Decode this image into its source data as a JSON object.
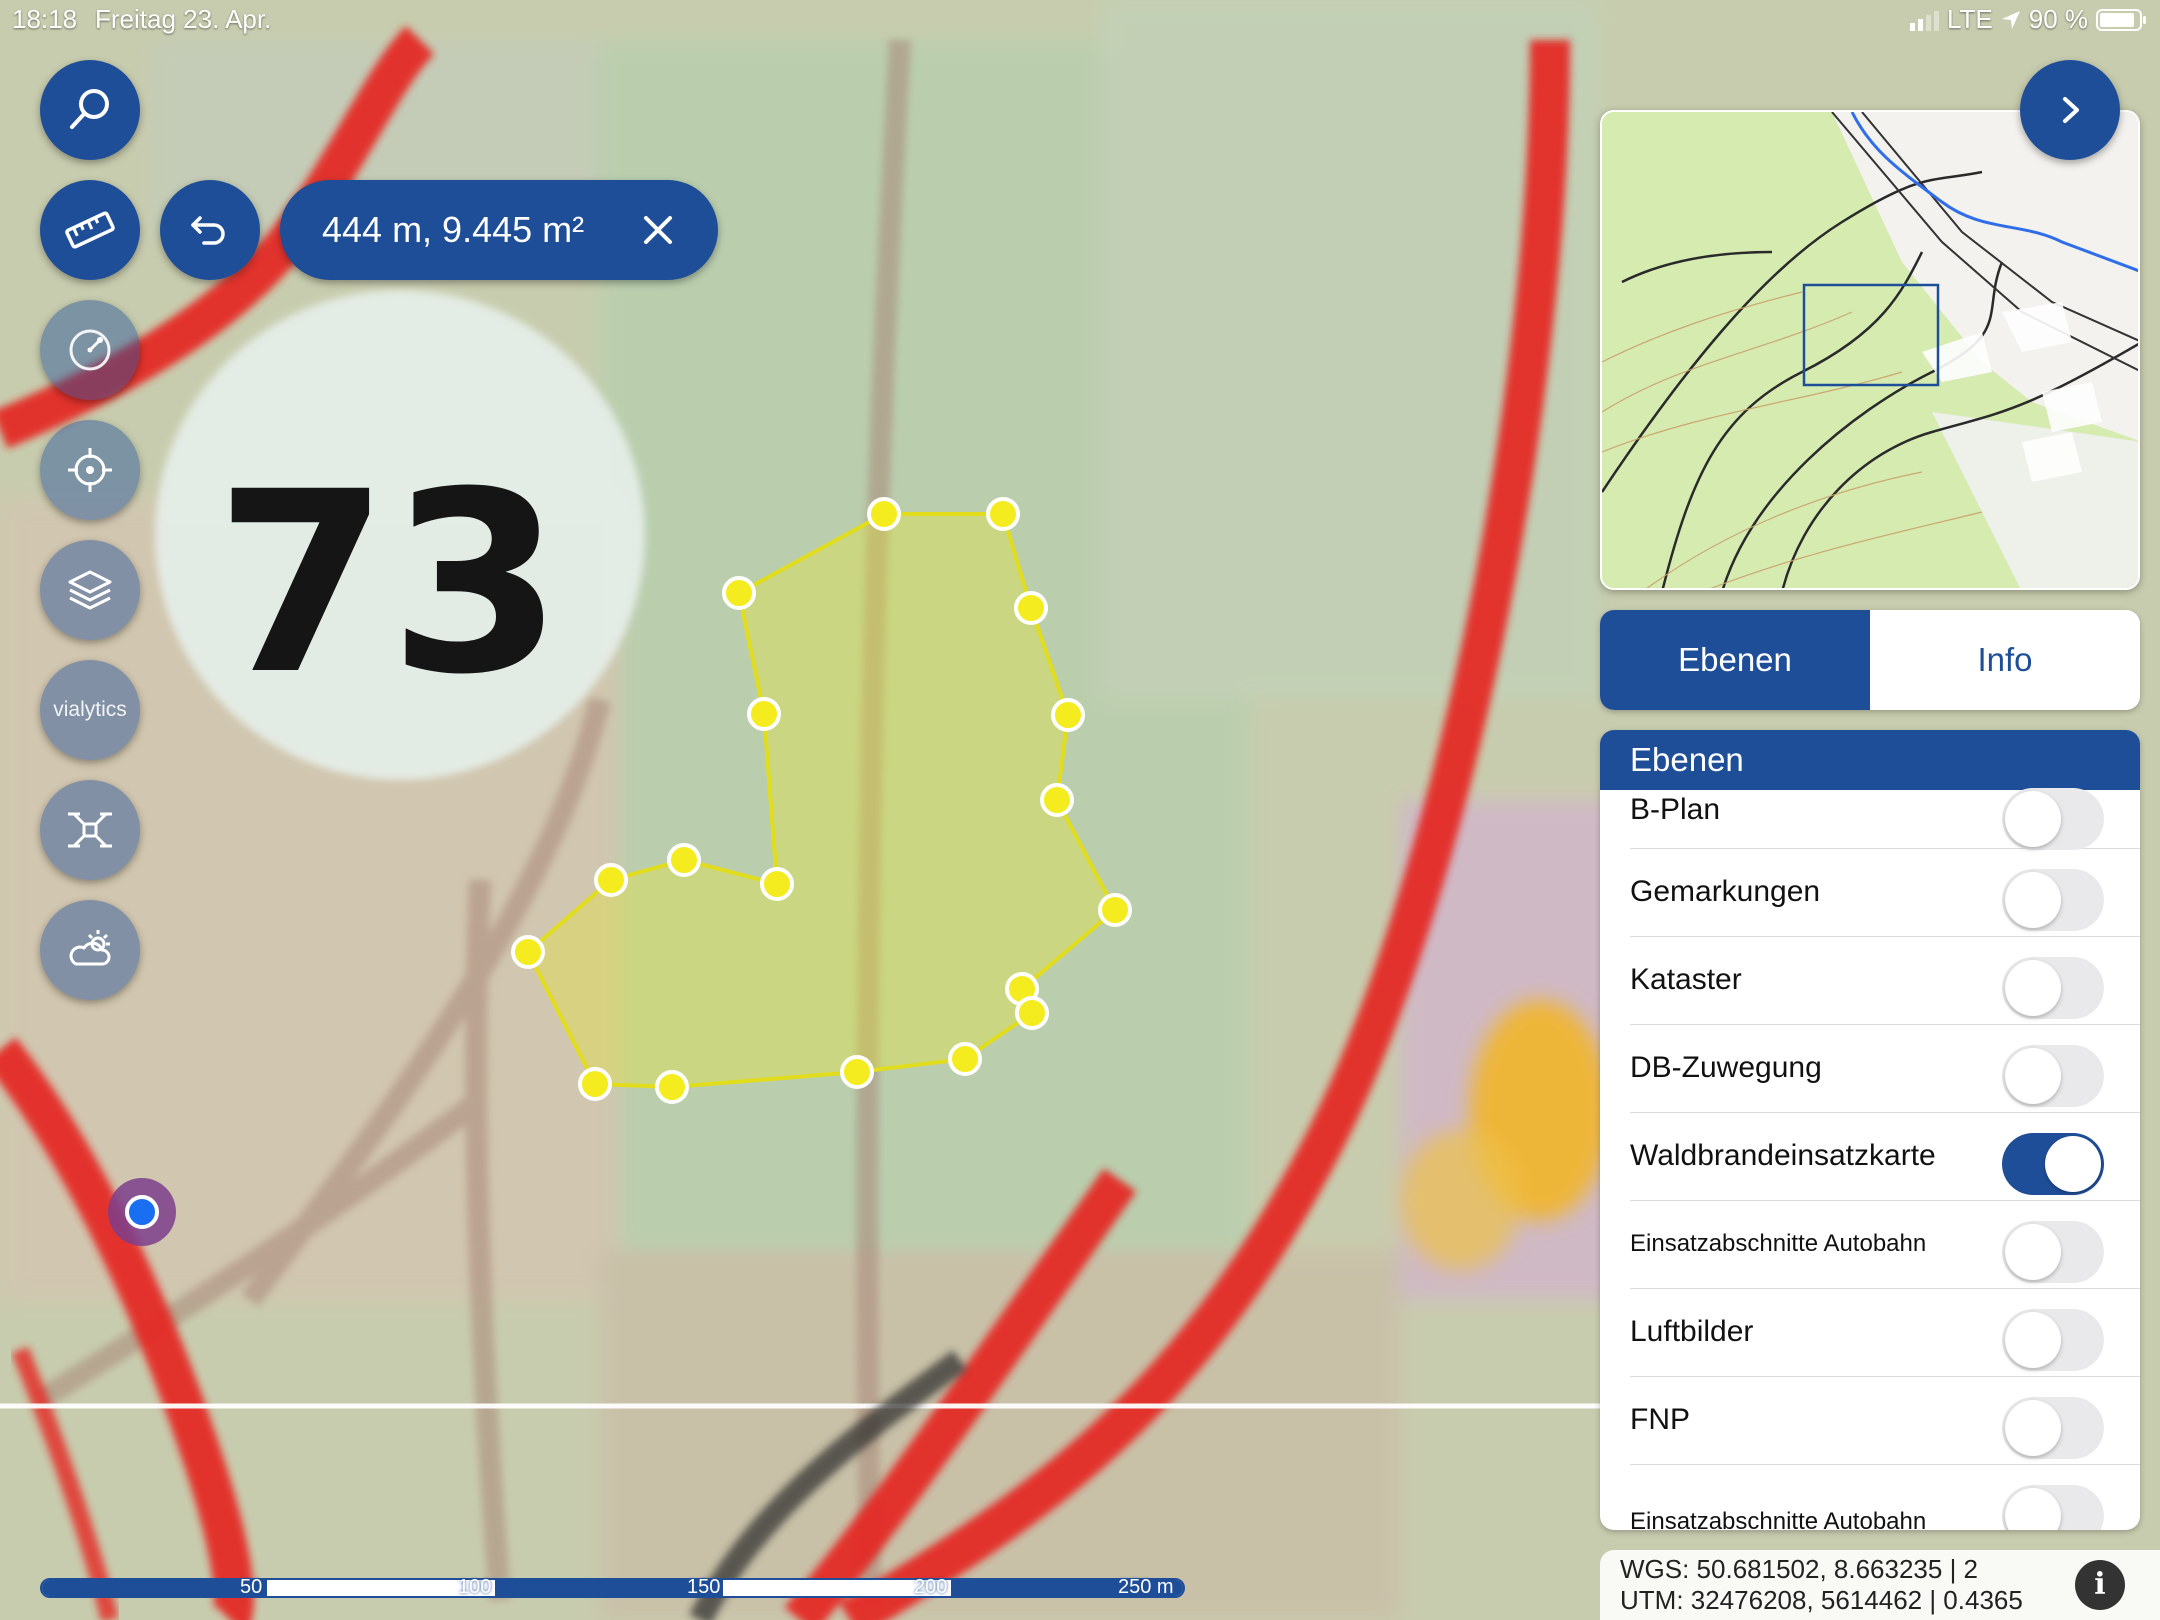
{
  "status_bar": {
    "time": "18:18",
    "date": "Freitag 23. Apr.",
    "network": "LTE",
    "battery": "90 %",
    "battery_level": 0.9
  },
  "map": {
    "label": "73",
    "accent_color": "#1f4e99",
    "polygon_color": "#f5ec1f"
  },
  "toolbar": {
    "vialytics_label": "vialytics",
    "measure_value": "444 m, 9.445 m²"
  },
  "panel": {
    "tabs": [
      {
        "label": "Ebenen",
        "active": true
      },
      {
        "label": "Info",
        "active": false
      }
    ],
    "layers_title": "Ebenen",
    "layers": [
      {
        "label": "B-Plan",
        "on": false
      },
      {
        "label": "Gemarkungen",
        "on": false
      },
      {
        "label": "Kataster",
        "on": false
      },
      {
        "label": "DB-Zuwegung",
        "on": false
      },
      {
        "label": "Waldbrandeinsatzkarte",
        "on": true
      },
      {
        "label": "Einsatzabschnitte Autobahn",
        "on": false
      },
      {
        "label": "Luftbilder",
        "on": false
      },
      {
        "label": "FNP",
        "on": false
      },
      {
        "label": "Einsatzabschnitte Autobahn",
        "on": false
      }
    ]
  },
  "coordinates": {
    "wgs": "WGS: 50.681502, 8.663235 | 2",
    "utm": "UTM: 32476208, 5614462 | 0.4365"
  },
  "scale_bar": {
    "labels": [
      "50",
      "100",
      "150",
      "200",
      "250 m"
    ]
  }
}
